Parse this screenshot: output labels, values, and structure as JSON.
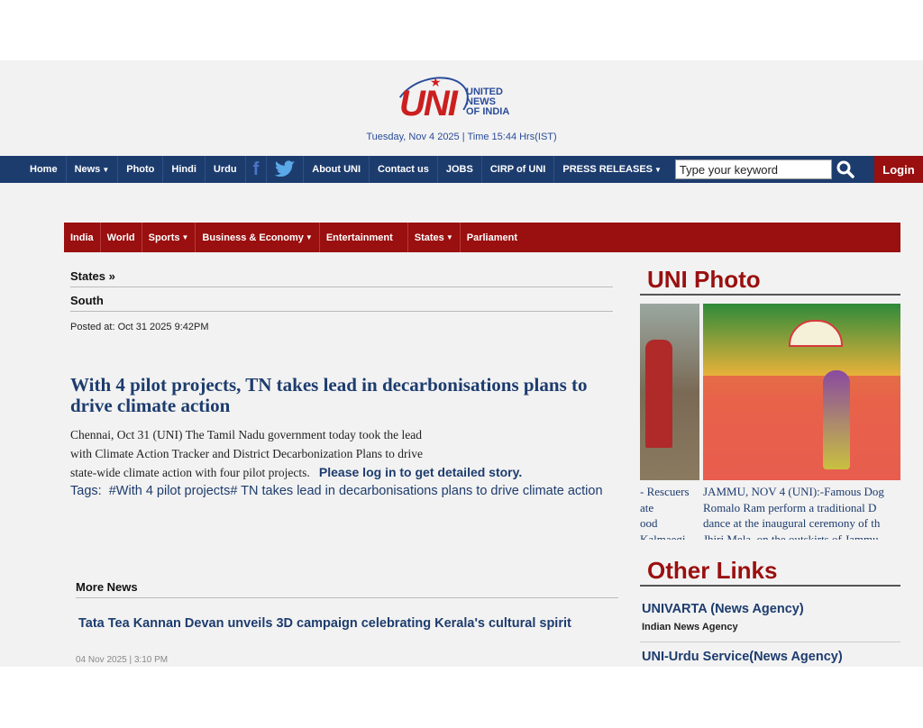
{
  "header": {
    "logo_text": "UNI",
    "logo_agency": [
      "UNITED",
      "NEWS",
      "OF INDIA"
    ],
    "datetime": "Tuesday, Nov 4 2025 | Time 15:44 Hrs(IST)"
  },
  "topnav": {
    "home": "Home",
    "news": "News",
    "photo": "Photo",
    "hindi": "Hindi",
    "urdu": "Urdu",
    "facebook": "f",
    "about": "About UNI",
    "contact": "Contact us",
    "jobs": "JOBS",
    "cirp": "CIRP of UNI",
    "press": "PRESS RELEASES",
    "search_placeholder": "Type your keyword",
    "login": "Login"
  },
  "catnav": {
    "india": "India",
    "world": "World",
    "sports": "Sports",
    "business": "Business & Economy",
    "entertainment": "Entertainment",
    "states": "States",
    "parliament": "Parliament"
  },
  "article": {
    "breadcrumb": "States »",
    "region": "South",
    "posted": "Posted at: Oct 31 2025 9:42PM",
    "headline": "With 4 pilot projects, TN takes lead in decarbonisations plans to drive climate action",
    "body_lines": [
      "Chennai, Oct 31 (UNI) The Tamil Nadu government today took the lead",
      "with Climate Action Tracker and District Decarbonization Plans to drive",
      "state-wide climate action with four pilot projects."
    ],
    "login_msg": "Please log in to get detailed story.",
    "tags_label": "Tags:",
    "tags_text": "#With 4 pilot projects# TN takes lead in decarbonisations plans to drive climate action"
  },
  "more_news": {
    "heading": "More News",
    "items": [
      {
        "title": "Tata Tea Kannan Devan unveils 3D campaign celebrating Kerala's cultural spirit",
        "date": "04 Nov 2025 | 3:10 PM"
      }
    ]
  },
  "uni_photo": {
    "heading": "UNI Photo",
    "captions": [
      [
        "- Rescuers",
        "ate",
        "ood",
        "Kalmaegi"
      ],
      [
        "JAMMU, NOV 4 (UNI):-Famous Dog",
        "Romalo Ram perform a traditional D",
        "dance at the inaugural ceremony of th",
        "Jhiri Mela, on the outskirts of Jammu"
      ]
    ]
  },
  "other_links": {
    "heading": "Other Links",
    "items": [
      {
        "title": "UNIVARTA (News Agency)",
        "subtitle": "Indian News Agency"
      },
      {
        "title": "UNI-Urdu Service(News Agency)",
        "subtitle": ""
      }
    ]
  },
  "colors": {
    "navy": "#1d3c6e",
    "brand_red": "#9a0f0f",
    "page_bg": "#f2f2f2"
  }
}
